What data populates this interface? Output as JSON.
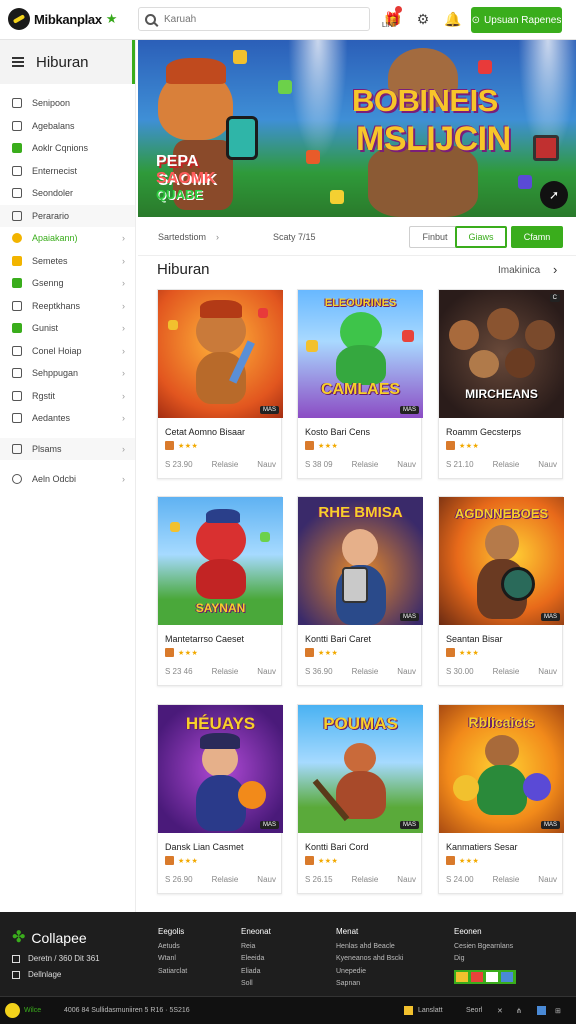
{
  "header": {
    "logo_text": "Mibkanplax",
    "search_placeholder": "Karuah",
    "gift_label": "LINT",
    "cta_label": "Upsuan Rapenes"
  },
  "sidebar": {
    "title": "Hiburan",
    "items": [
      {
        "label": "Senipoon"
      },
      {
        "label": "Agebalans"
      },
      {
        "label": "Aoklr Cqnions"
      },
      {
        "label": "Enternecist"
      },
      {
        "label": "Seondoler"
      },
      {
        "label": "Perarario"
      },
      {
        "label": "Apaiakann)"
      },
      {
        "label": "Semetes"
      },
      {
        "label": "Gsenng"
      },
      {
        "label": "Reeptkhans"
      },
      {
        "label": "Gunist"
      },
      {
        "label": "Conel Hoiap"
      },
      {
        "label": "Sehppugan"
      },
      {
        "label": "Rgstit"
      },
      {
        "label": "Aedantes"
      },
      {
        "label": "Plsams"
      },
      {
        "label": "Aeln Odcbi"
      }
    ]
  },
  "hero": {
    "title_line1": "BOBINEIS",
    "title_line2": "MSLIJCIN",
    "sub_line1": "PEPA",
    "sub_line2": "SAOMK",
    "sub_line3": "QUABE"
  },
  "filters": {
    "left_label": "Sartedstiom",
    "mid_label": "Scaty 7/15",
    "btn1": "Finbut",
    "btn2": "Giaws",
    "btn3": "Cfamn"
  },
  "section": {
    "title": "Hiburan",
    "link": "Imakinica"
  },
  "cards": [
    {
      "name": "Cetat Aomno Bisaar",
      "thumb_title": "",
      "price": "S 23.90",
      "mid": "Relasie",
      "right": "Nauv"
    },
    {
      "name": "Kosto Bari Cens",
      "thumb_title": "CAMLAES",
      "price": "S 38 09",
      "mid": "Relasie",
      "right": "Nauv"
    },
    {
      "name": "Roamm Gecsterps",
      "thumb_title": "MIRCHEANS",
      "price": "S 21.10",
      "mid": "Relasie",
      "right": "Nauv"
    },
    {
      "name": "Mantetarrso Caeset",
      "thumb_title": "",
      "price": "S 23 46",
      "mid": "Relasie",
      "right": "Nauv"
    },
    {
      "name": "Kontti Bari Caret",
      "thumb_title": "RHE BMISA",
      "price": "S 36.90",
      "mid": "Relasie",
      "right": "Nauv"
    },
    {
      "name": "Seantan Bisar",
      "thumb_title": "AGDNNEBOES",
      "price": "S 30.00",
      "mid": "Relasie",
      "right": "Nauv"
    },
    {
      "name": "Dansk Lian Casmet",
      "thumb_title": "HÉUAYS",
      "price": "S 26.90",
      "mid": "Relasie",
      "right": "Nauv"
    },
    {
      "name": "Kontti Bari Cord",
      "thumb_title": "POUMAS",
      "price": "S 26.15",
      "mid": "Relasie",
      "right": "Nauv"
    },
    {
      "name": "Kanmatiers Sesar",
      "thumb_title": "Rblicaicts",
      "price": "S 24.00",
      "mid": "Relasie",
      "right": "Nauv"
    }
  ],
  "footer": {
    "brand": "Collapee",
    "line1": "Deretn / 360 Dit 361",
    "line2": "Dellnlage",
    "col1_head": "Eegolis",
    "col1": [
      "Aetuds",
      "Wtanl",
      "Satiarclat"
    ],
    "col2_head": "Eneonat",
    "col2": [
      "Reia",
      "Eleeida",
      "Eliada",
      "Soll"
    ],
    "col3_head": "Menat",
    "col3": [
      "Henlas ahd Beacle",
      "Kyeneanos ahd Bscki",
      "Unepedie",
      "Sapnan"
    ],
    "col4_head": "Eeonen",
    "col4": [
      "Cesien Bgearnlans",
      "Dig"
    ]
  },
  "bottombar": {
    "left": "Wilce",
    "mid": "4006 84 Sullidasmuniiren 5 R16 · 5S216",
    "r1": "Lanslatt",
    "r2": "Seorl"
  }
}
